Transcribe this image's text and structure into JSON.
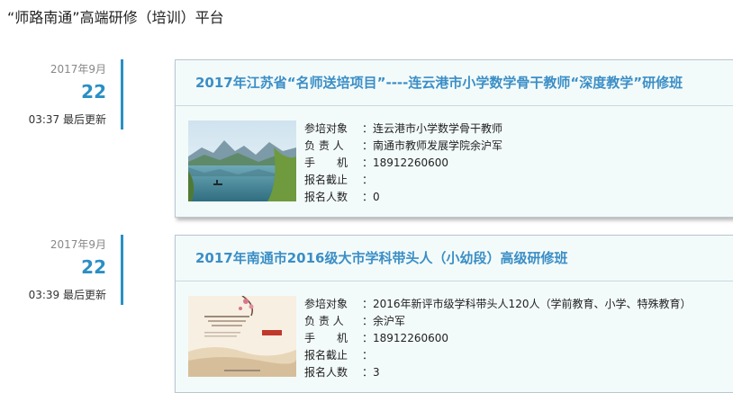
{
  "page": {
    "title": "“师路南通”高端研修（培训）平台"
  },
  "entries": [
    {
      "date": {
        "month": "2017年9月",
        "day": "22",
        "update_time": "03:37 最后更新"
      },
      "title": "2017年江苏省“名师送培项目”----连云港市小学数学骨干教师“深度教学”研修班",
      "image": "landscape-photo-lake-mountains",
      "fields": [
        {
          "label": "参培对象",
          "value": "连云港市小学数学骨干教师"
        },
        {
          "label": "负 责 人",
          "value": "南通市教师发展学院余沪军"
        },
        {
          "label": "手　　机",
          "value": "18912260600"
        },
        {
          "label": "报名截止",
          "value": ""
        },
        {
          "label": "报名人数",
          "value": "0"
        }
      ]
    },
    {
      "date": {
        "month": "2017年9月",
        "day": "22",
        "update_time": "03:39 最后更新"
      },
      "title": "2017年南通市2016级大市学科带头人（小幼段）高级研修班",
      "image": "study-handbook-cover",
      "fields": [
        {
          "label": "参培对象",
          "value": "2016年新评市级学科带头人120人（学前教育、小学、特殊教育）"
        },
        {
          "label": "负 责 人",
          "value": "余沪军"
        },
        {
          "label": "手　　机",
          "value": "18912260600"
        },
        {
          "label": "报名截止",
          "value": ""
        },
        {
          "label": "报名人数",
          "value": "3"
        }
      ]
    }
  ]
}
